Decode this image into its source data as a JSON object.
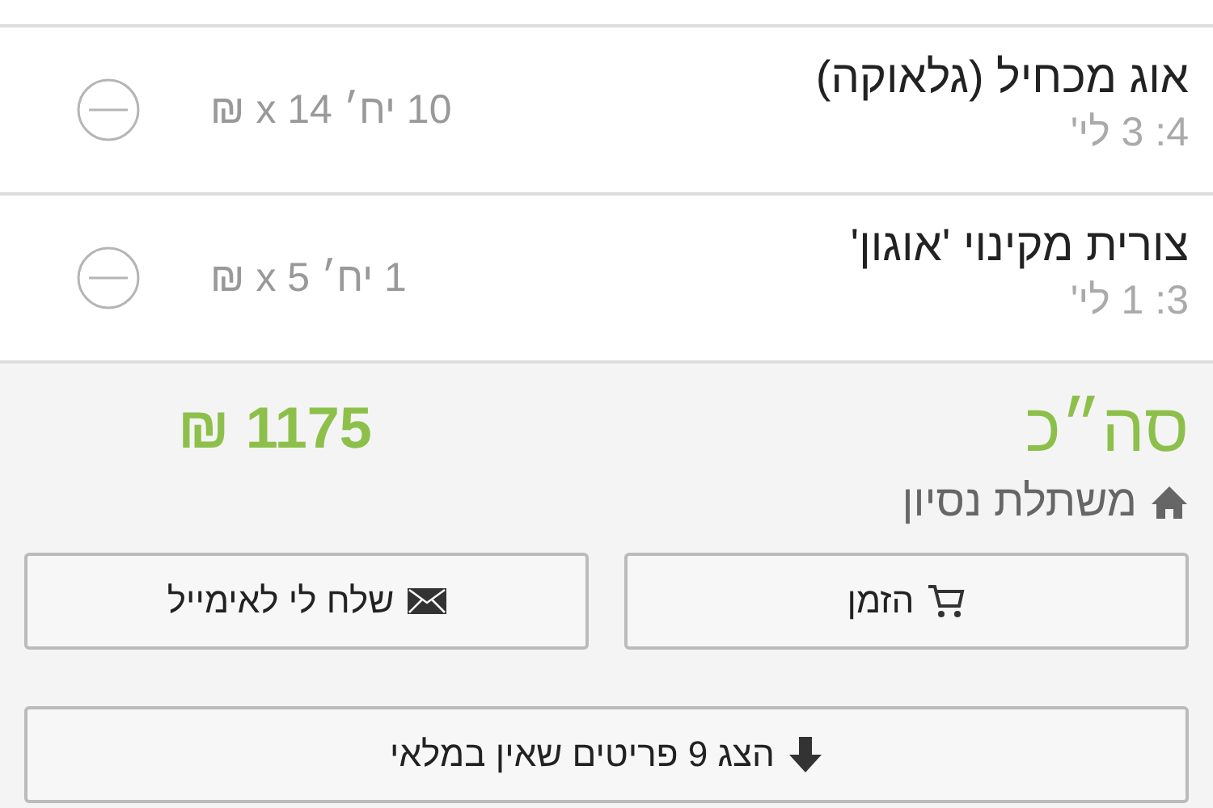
{
  "items": [
    {
      "name": "אוג מכחיל (גלאוקה)",
      "detail": "4: 3 לי'",
      "quantity": "10 יח׳ x 14 ₪"
    },
    {
      "name": "צורית מקינוי 'אוגון'",
      "detail": "3: 1 לי'",
      "quantity": "1 יח׳ x 5 ₪"
    }
  ],
  "summary": {
    "label": "סה״כ",
    "total": "1175 ₪",
    "nursery": "משתלת נסיון"
  },
  "buttons": [
    {
      "kind": "order",
      "label": "הזמן"
    },
    {
      "kind": "email",
      "label": "שלח לי לאימייל"
    }
  ],
  "show_more": {
    "label": "הצג 9 פריטים שאין במלאי"
  }
}
